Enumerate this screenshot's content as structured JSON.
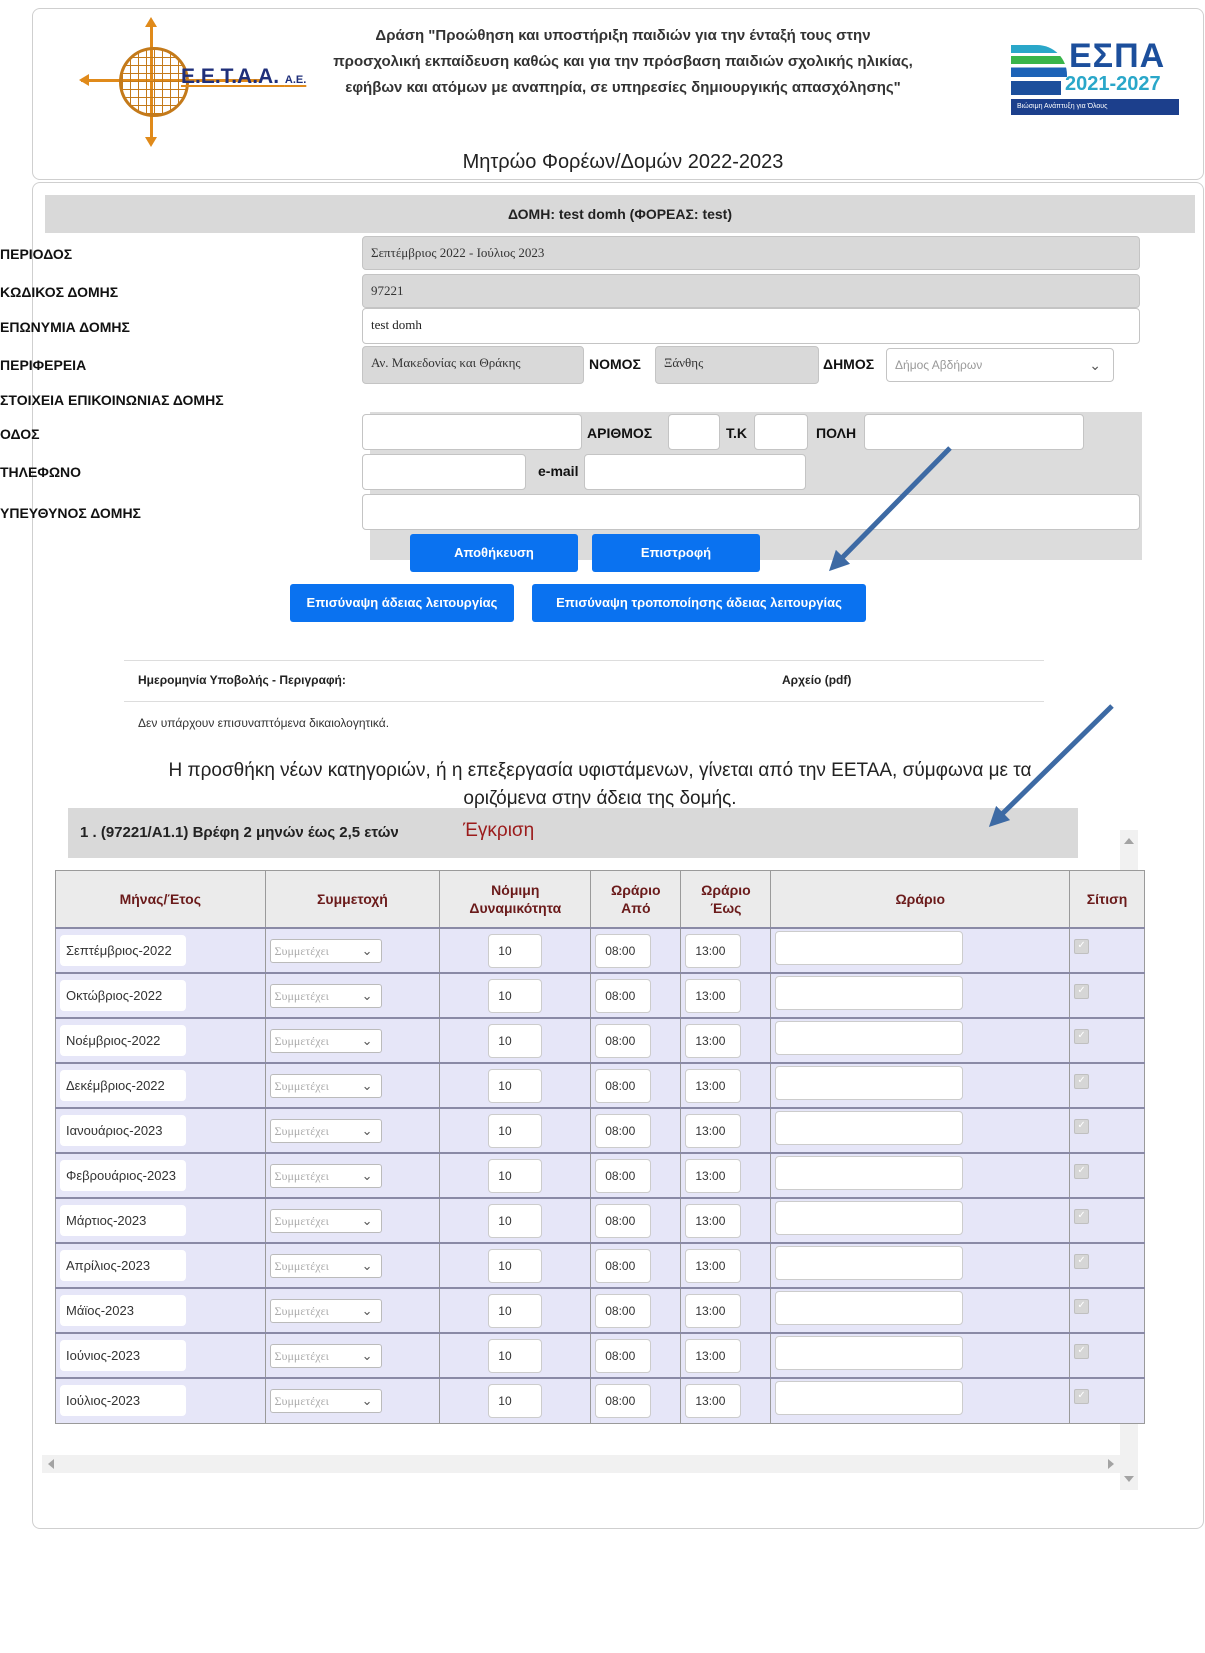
{
  "header": {
    "action_title": "Δράση \"Προώθηση και υποστήριξη παιδιών για την ένταξή τους στην προσχολική εκπαίδευση καθώς και για την πρόσβαση παιδιών σχολικής ηλικίας, εφήβων και ατόμων με αναπηρία, σε υπηρεσίες δημιουργικής απασχόλησης\"",
    "registry_title": "Μητρώο Φορέων/Δομών 2022-2023",
    "logo_left": "Ε.Ε.Τ.Α.Α.",
    "logo_left_suffix": "Α.Ε.",
    "logo_right": "ΕΣΠΑ",
    "logo_right_years": "2021-2027",
    "logo_right_tagline": "Βιώσιμη Ανάπτυξη για Όλους"
  },
  "structure_bar": "ΔΟΜΗ: test domh (ΦΟΡΕΑΣ: test)",
  "form": {
    "period_label": "ΠΕΡΙΟΔΟΣ",
    "period_value": "Σεπτέμβριος 2022 - Ιούλιος 2023",
    "code_label": "ΚΩΔΙΚΟΣ ΔΟΜΗΣ",
    "code_value": "97221",
    "name_label": "ΕΠΩΝΥΜΙΑ ΔΟΜΗΣ",
    "name_value": "test domh",
    "region_label": "ΠΕΡΙΦΕΡΕΙΑ",
    "region_value": "Αν. Μακεδονίας και Θράκης",
    "prefecture_label": "ΝΟΜΟΣ",
    "prefecture_value": "Ξάνθης",
    "municipality_label": "ΔΗΜΟΣ",
    "municipality_value": "Δήμος Αβδήρων",
    "contact_label": "ΣΤΟΙΧΕΙΑ ΕΠΙΚΟΙΝΩΝΙΑΣ ΔΟΜΗΣ",
    "street_label": "ΟΔΟΣ",
    "street_value": "",
    "number_label": "ΑΡΙΘΜΟΣ",
    "number_value": "",
    "postcode_label": "Τ.Κ",
    "postcode_value": "",
    "city_label": "ΠΟΛΗ",
    "city_value": "",
    "phone_label": "ΤΗΛΕΦΩΝΟ",
    "phone_value": "",
    "email_label": "e-mail",
    "email_value": "",
    "manager_label": "ΥΠΕΥΘΥΝΟΣ ΔΟΜΗΣ",
    "manager_value": ""
  },
  "buttons": {
    "save": "Αποθήκευση",
    "back": "Επιστροφή",
    "attach_license": "Επισύναψη άδειας λειτουργίας",
    "attach_license_amendment": "Επισύναψη τροποποίησης άδειας λειτουργίας"
  },
  "docs": {
    "col_date": "Ημερομηνία Υποβολής - Περιγραφή:",
    "col_file": "Αρχείο (pdf)",
    "empty": "Δεν υπάρχουν επισυναπτόμενα δικαιολογητικά."
  },
  "notice": "Η προσθήκη νέων κατηγοριών, ή η επεξεργασία υφιστάμενων, γίνεται από την ΕΕΤΑΑ, σύμφωνα με τα οριζόμενα στην άδεια της δομής.",
  "category": {
    "title": "1 . (97221/Α1.1) Βρέφη 2 μηνών έως 2,5 ετών",
    "status": "Έγκριση"
  },
  "table": {
    "headers": [
      "Μήνας/Έτος",
      "Συμμετοχή",
      "Νόμιμη Δυναμικότητα",
      "Ωράριο Από",
      "Ωράριο Έως",
      "Ωράριο",
      "Σίτιση"
    ],
    "rows": [
      {
        "month": "Σεπτέμβριος-2022",
        "participation": "Συμμετέχει",
        "capacity": "10",
        "from": "08:00",
        "to": "13:00",
        "schedule": ""
      },
      {
        "month": "Οκτώβριος-2022",
        "participation": "Συμμετέχει",
        "capacity": "10",
        "from": "08:00",
        "to": "13:00",
        "schedule": ""
      },
      {
        "month": "Νοέμβριος-2022",
        "participation": "Συμμετέχει",
        "capacity": "10",
        "from": "08:00",
        "to": "13:00",
        "schedule": ""
      },
      {
        "month": "Δεκέμβριος-2022",
        "participation": "Συμμετέχει",
        "capacity": "10",
        "from": "08:00",
        "to": "13:00",
        "schedule": ""
      },
      {
        "month": "Ιανουάριος-2023",
        "participation": "Συμμετέχει",
        "capacity": "10",
        "from": "08:00",
        "to": "13:00",
        "schedule": ""
      },
      {
        "month": "Φεβρουάριος-2023",
        "participation": "Συμμετέχει",
        "capacity": "10",
        "from": "08:00",
        "to": "13:00",
        "schedule": ""
      },
      {
        "month": "Μάρτιος-2023",
        "participation": "Συμμετέχει",
        "capacity": "10",
        "from": "08:00",
        "to": "13:00",
        "schedule": ""
      },
      {
        "month": "Απρίλιος-2023",
        "participation": "Συμμετέχει",
        "capacity": "10",
        "from": "08:00",
        "to": "13:00",
        "schedule": ""
      },
      {
        "month": "Μάϊος-2023",
        "participation": "Συμμετέχει",
        "capacity": "10",
        "from": "08:00",
        "to": "13:00",
        "schedule": ""
      },
      {
        "month": "Ιούνιος-2023",
        "participation": "Συμμετέχει",
        "capacity": "10",
        "from": "08:00",
        "to": "13:00",
        "schedule": ""
      },
      {
        "month": "Ιούλιος-2023",
        "participation": "Συμμετέχει",
        "capacity": "10",
        "from": "08:00",
        "to": "13:00",
        "schedule": ""
      }
    ]
  },
  "colors": {
    "accent_button": "#0a72f0",
    "status_text": "#9b1b1b",
    "table_row_bg": "#e6e6f8",
    "annotation_arrow": "#3d6aa4"
  }
}
